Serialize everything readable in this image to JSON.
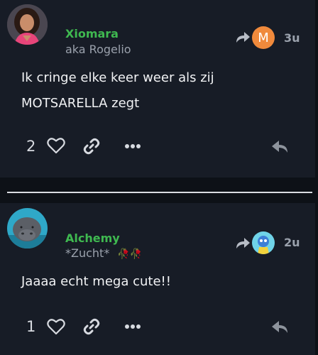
{
  "posts": [
    {
      "username": "Xiomara",
      "subtitle": "aka Rogelio",
      "body": [
        "Ik cringe elke keer weer als zij",
        "MOTSARELLA zegt"
      ],
      "reshare_avatar_letter": "M",
      "time": "3u",
      "like_count": "2"
    },
    {
      "username": "Alchemy",
      "subtitle": "*Zucht*",
      "subtitle_emoji": "🥀🥀",
      "body": [
        "Jaaaa echt mega cute!!"
      ],
      "time": "2u",
      "like_count": "1"
    }
  ],
  "icons": [
    "reshare-icon",
    "heart-icon",
    "link-icon",
    "more-icon",
    "reply-icon"
  ],
  "colors": {
    "background": "#0d1117",
    "card": "#171c26",
    "username": "#3fb950",
    "muted": "#9aa1ac",
    "reshare_avatar": "#f08a3c"
  }
}
